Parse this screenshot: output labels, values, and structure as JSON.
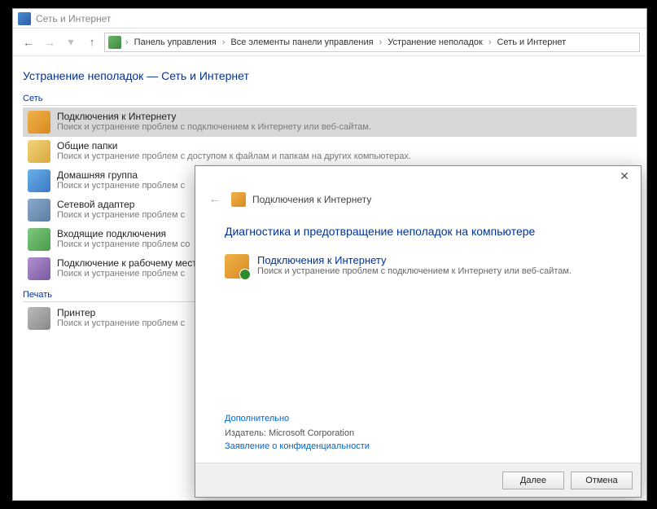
{
  "window": {
    "title": "Сеть и Интернет"
  },
  "breadcrumb": {
    "segments": [
      "Панель управления",
      "Все элементы панели управления",
      "Устранение неполадок",
      "Сеть и Интернет"
    ]
  },
  "page": {
    "heading": "Устранение неполадок — Сеть и Интернет"
  },
  "sections": {
    "network": {
      "label": "Сеть",
      "items": [
        {
          "title": "Подключения к Интернету",
          "desc": "Поиск и устранение проблем с подключением к Интернету или веб-сайтам."
        },
        {
          "title": "Общие папки",
          "desc": "Поиск и устранение проблем с доступом к файлам и папкам на других компьютерах."
        },
        {
          "title": "Домашняя группа",
          "desc": "Поиск и устранение проблем с"
        },
        {
          "title": "Сетевой адаптер",
          "desc": "Поиск и устранение проблем с"
        },
        {
          "title": "Входящие подключения",
          "desc": "Поиск и устранение проблем со"
        },
        {
          "title": "Подключение к рабочему месту",
          "desc": "Поиск и устранение проблем с"
        }
      ]
    },
    "print": {
      "label": "Печать",
      "items": [
        {
          "title": "Принтер",
          "desc": "Поиск и устранение проблем с"
        }
      ]
    }
  },
  "dialog": {
    "header_title": "Подключения к Интернету",
    "heading": "Диагностика и предотвращение неполадок на компьютере",
    "item": {
      "title": "Подключения к Интернету",
      "desc": "Поиск и устранение проблем с подключением к Интернету или веб-сайтам."
    },
    "advanced_link": "Дополнительно",
    "publisher_label": "Издатель:",
    "publisher_value": "Microsoft Corporation",
    "privacy_link": "Заявление о конфиденциальности",
    "buttons": {
      "next": "Далее",
      "cancel": "Отмена"
    }
  }
}
